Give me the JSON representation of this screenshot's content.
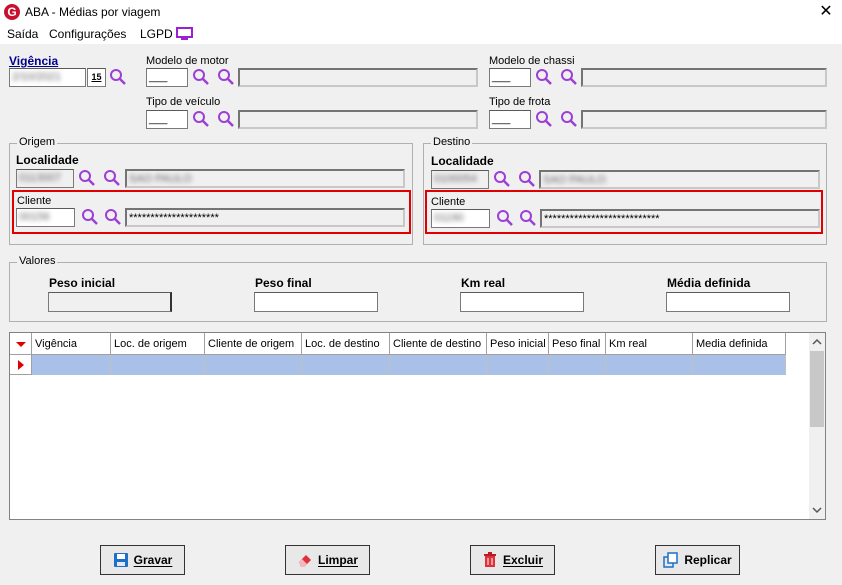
{
  "window": {
    "title": "ABA - Médias por viagem",
    "close_glyph": "✕",
    "icon_letter": "G"
  },
  "menu": {
    "items": [
      "Saída",
      "Configurações",
      "LGPD"
    ]
  },
  "vigencia": {
    "label": "Vigência",
    "value": "2/10/2021",
    "calendar_label": "15"
  },
  "modelo_motor": {
    "label": "Modelo de motor",
    "code": "___"
  },
  "modelo_chassi": {
    "label": "Modelo de chassi",
    "code": "___"
  },
  "tipo_veiculo": {
    "label": "Tipo de veículo",
    "code": "___"
  },
  "tipo_frota": {
    "label": "Tipo de frota",
    "code": "___"
  },
  "origem": {
    "group_title": "Origem",
    "localidade_label": "Localidade",
    "localidade_code": "0113007",
    "localidade_name": "SAO PAULO",
    "cliente_label": "Cliente",
    "cliente_code": "00156",
    "cliente_name": "*********************"
  },
  "destino": {
    "group_title": "Destino",
    "localidade_label": "Localidade",
    "localidade_code": "0100054",
    "localidade_name": "SAO PAULO",
    "cliente_label": "Cliente",
    "cliente_code": "01190",
    "cliente_name": "***************************"
  },
  "valores": {
    "group_title": "Valores",
    "peso_inicial_label": "Peso inicial",
    "peso_final_label": "Peso final",
    "km_real_label": "Km real",
    "media_definida_label": "Média definida"
  },
  "grid": {
    "columns": [
      "Vigência",
      "Loc. de origem",
      "Cliente de origem",
      "Loc. de destino",
      "Cliente de destino",
      "Peso inicial",
      "Peso final",
      "Km real",
      "Media definida"
    ]
  },
  "buttons": {
    "gravar": "Gravar",
    "limpar": "Limpar",
    "excluir": "Excluir",
    "replicar": "Replicar"
  },
  "colors": {
    "highlight": "#e00000",
    "selected_row": "#a9c0e8",
    "magnifier": "#9b3fd6",
    "brand": "#c8102e"
  }
}
